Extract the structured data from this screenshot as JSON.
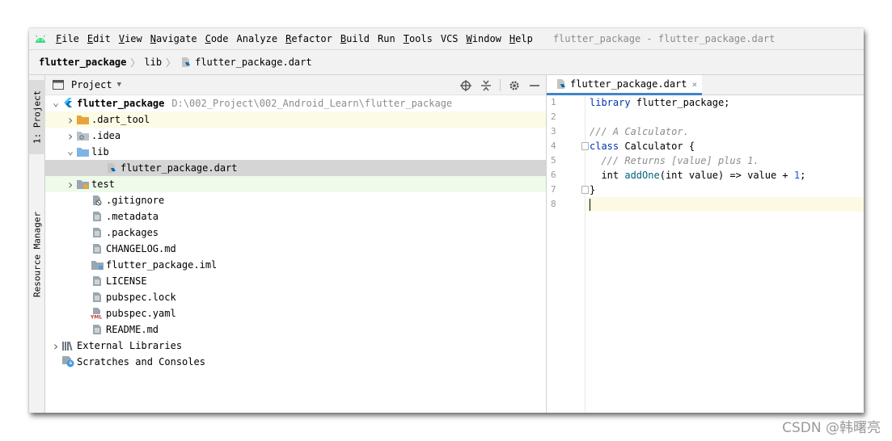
{
  "menu": {
    "items": [
      {
        "u": "F",
        "rest": "ile"
      },
      {
        "u": "E",
        "rest": "dit"
      },
      {
        "u": "V",
        "rest": "iew"
      },
      {
        "u": "N",
        "rest": "avigate"
      },
      {
        "u": "C",
        "rest": "ode"
      },
      {
        "u": "",
        "rest": "Analyze"
      },
      {
        "u": "R",
        "rest": "efactor"
      },
      {
        "u": "B",
        "rest": "uild"
      },
      {
        "u": "",
        "rest": "Run"
      },
      {
        "u": "T",
        "rest": "ools"
      },
      {
        "u": "",
        "rest": "VCS"
      },
      {
        "u": "W",
        "rest": "indow"
      },
      {
        "u": "H",
        "rest": "elp"
      }
    ],
    "window_title": "flutter_package - flutter_package.dart"
  },
  "breadcrumb": {
    "project": "flutter_package",
    "folder": "lib",
    "file": "flutter_package.dart",
    "sep": "〉"
  },
  "strip": {
    "project_tab": "1: Project",
    "resource_tab": "Resource Manager"
  },
  "project_panel": {
    "title": "Project",
    "tree": [
      {
        "label": "flutter_package",
        "hint": "D:\\002_Project\\002_Android_Learn\\flutter_package",
        "icon": "flutter-icon",
        "indent": 0,
        "arrow": "open"
      },
      {
        "label": ".dart_tool",
        "icon": "orange-folder-icon",
        "indent": 1,
        "arrow": "closed",
        "hl": "yellow"
      },
      {
        "label": ".idea",
        "icon": "settings-folder-icon",
        "indent": 1,
        "arrow": "closed"
      },
      {
        "label": "lib",
        "icon": "blue-folder-icon",
        "indent": 1,
        "arrow": "open"
      },
      {
        "label": "flutter_package.dart",
        "icon": "dart-file-icon",
        "indent": 3,
        "arrow": "none",
        "selected": true
      },
      {
        "label": "test",
        "icon": "test-folder-icon",
        "indent": 1,
        "arrow": "closed",
        "hl": "green"
      },
      {
        "label": ".gitignore",
        "icon": "ignore-file-icon",
        "indent": 2,
        "arrow": "none"
      },
      {
        "label": ".metadata",
        "icon": "text-file-icon",
        "indent": 2,
        "arrow": "none"
      },
      {
        "label": ".packages",
        "icon": "text-file-icon",
        "indent": 2,
        "arrow": "none"
      },
      {
        "label": "CHANGELOG.md",
        "icon": "text-file-icon",
        "indent": 2,
        "arrow": "none"
      },
      {
        "label": "flutter_package.iml",
        "icon": "module-file-icon",
        "indent": 2,
        "arrow": "none"
      },
      {
        "label": "LICENSE",
        "icon": "text-file-icon",
        "indent": 2,
        "arrow": "none"
      },
      {
        "label": "pubspec.lock",
        "icon": "text-file-icon",
        "indent": 2,
        "arrow": "none"
      },
      {
        "label": "pubspec.yaml",
        "icon": "yaml-file-icon",
        "indent": 2,
        "arrow": "none"
      },
      {
        "label": "README.md",
        "icon": "text-file-icon",
        "indent": 2,
        "arrow": "none"
      },
      {
        "label": "External Libraries",
        "icon": "libraries-icon",
        "indent": 0,
        "arrow": "closed"
      },
      {
        "label": "Scratches and Consoles",
        "icon": "scratches-icon",
        "indent": 0,
        "arrow": "none"
      }
    ]
  },
  "editor": {
    "tab_label": "flutter_package.dart",
    "tab_close": "×",
    "line_numbers": [
      "1",
      "2",
      "3",
      "4",
      "5",
      "6",
      "7",
      "8"
    ]
  },
  "watermark": "CSDN @韩曙亮",
  "colors": {
    "keyword": "#0033b3",
    "comment": "#8c8c8c",
    "function": "#00627a",
    "number": "#1750eb",
    "tab_underline": "#4083c9",
    "selected_row": "#d5d5d5"
  }
}
